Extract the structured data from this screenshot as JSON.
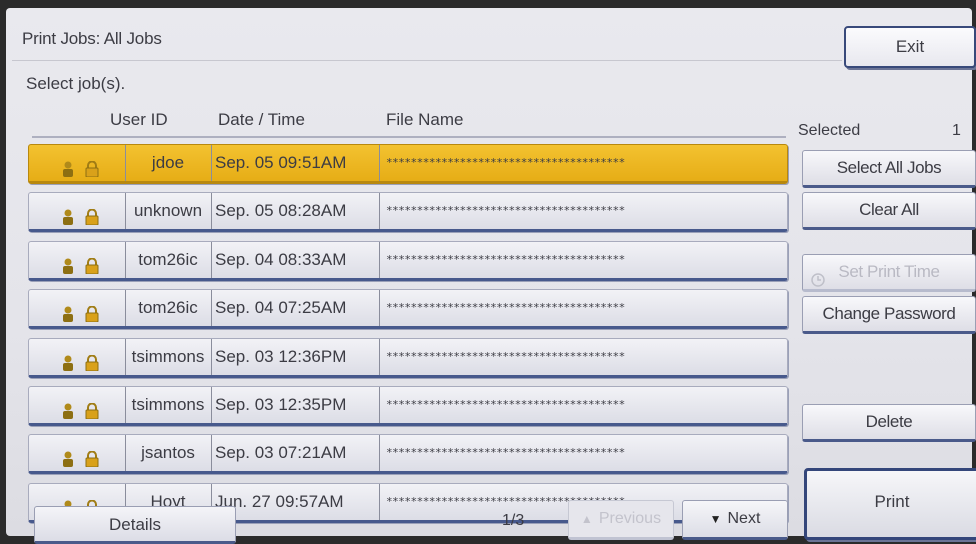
{
  "title": "Print Jobs: All Jobs",
  "exit_label": "Exit",
  "instruction": "Select job(s).",
  "columns": {
    "user_id": "User ID",
    "date_time": "Date / Time",
    "file_name": "File Name"
  },
  "jobs": [
    {
      "user": "jdoe",
      "datetime": "Sep. 05 09:51AM",
      "file": "***************************************",
      "selected": true
    },
    {
      "user": "unknown",
      "datetime": "Sep. 05 08:28AM",
      "file": "***************************************",
      "selected": false
    },
    {
      "user": "tom26ic",
      "datetime": "Sep. 04 08:33AM",
      "file": "***************************************",
      "selected": false
    },
    {
      "user": "tom26ic",
      "datetime": "Sep. 04 07:25AM",
      "file": "***************************************",
      "selected": false
    },
    {
      "user": "tsimmons",
      "datetime": "Sep. 03 12:36PM",
      "file": "***************************************",
      "selected": false
    },
    {
      "user": "tsimmons",
      "datetime": "Sep. 03 12:35PM",
      "file": "***************************************",
      "selected": false
    },
    {
      "user": "jsantos",
      "datetime": "Sep. 03 07:21AM",
      "file": "***************************************",
      "selected": false
    },
    {
      "user": "Hoyt",
      "datetime": "Jun. 27 09:57AM",
      "file": "***************************************",
      "selected": false
    }
  ],
  "selected": {
    "label": "Selected",
    "count": "1"
  },
  "side_buttons": {
    "select_all": "Select All Jobs",
    "clear_all": "Clear All",
    "set_print_time": "Set Print Time",
    "change_password": "Change Password",
    "delete": "Delete"
  },
  "print_label": "Print",
  "details_label": "Details",
  "page_indicator": "1/3",
  "previous_label": "Previous",
  "next_label": "Next",
  "colors": {
    "selected_row": "#f0bc27",
    "accent_border": "#47598c"
  },
  "icons": {
    "row_user": "user-icon",
    "row_lock": "lock-icon",
    "set_time": "clock-icon",
    "prev": "triangle-up-icon",
    "next": "triangle-down-icon"
  }
}
